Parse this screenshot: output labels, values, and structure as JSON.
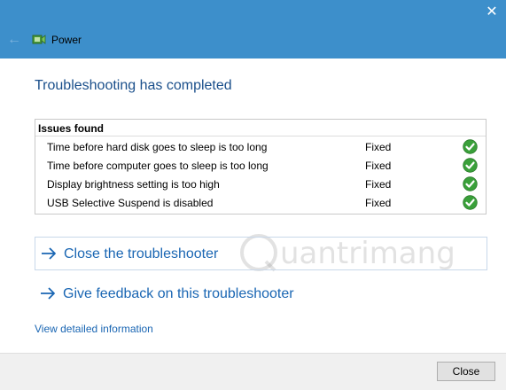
{
  "window": {
    "close_glyph": "✕",
    "back_glyph": "←",
    "title": "Power",
    "icon": "power-options-icon"
  },
  "main": {
    "heading": "Troubleshooting has completed",
    "issues": {
      "header": "Issues found",
      "rows": [
        {
          "text": "Time before hard disk goes to sleep is too long",
          "status": "Fixed"
        },
        {
          "text": "Time before computer goes to sleep is too long",
          "status": "Fixed"
        },
        {
          "text": "Display brightness setting is too high",
          "status": "Fixed"
        },
        {
          "text": "USB Selective Suspend is disabled",
          "status": "Fixed"
        }
      ]
    },
    "links": {
      "close_troubleshooter": "Close the troubleshooter",
      "give_feedback": "Give feedback on this troubleshooter"
    },
    "detail_link": "View detailed information"
  },
  "footer": {
    "close_label": "Close"
  },
  "watermark": {
    "text": "uantrimang"
  },
  "colors": {
    "titlebar": "#3d8fcb",
    "heading": "#1a4f8b",
    "link": "#1a66b3",
    "check_green": "#3aa03a"
  }
}
